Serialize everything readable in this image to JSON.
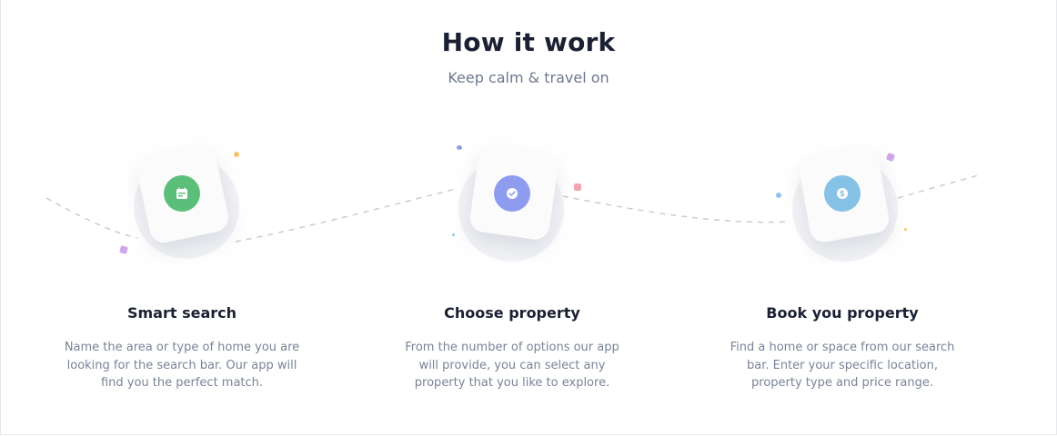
{
  "section": {
    "title": "How it work",
    "subtitle": "Keep calm & travel on"
  },
  "steps": [
    {
      "title": "Smart search",
      "description": "Name the area or type of home you are looking for the search bar. Our app will find you the perfect match.",
      "icon": "calendar-icon",
      "color": "#5bbf7a"
    },
    {
      "title": "Choose property",
      "description": "From the number of options our app will provide, you can select any property that you like to explore.",
      "icon": "check-circle-icon",
      "color": "#8e9cf0"
    },
    {
      "title": "Book you property",
      "description": "Find a home or space from our search bar. Enter your specific location, property type and price range.",
      "icon": "dollar-coin-icon",
      "color": "#86c1e6"
    }
  ]
}
